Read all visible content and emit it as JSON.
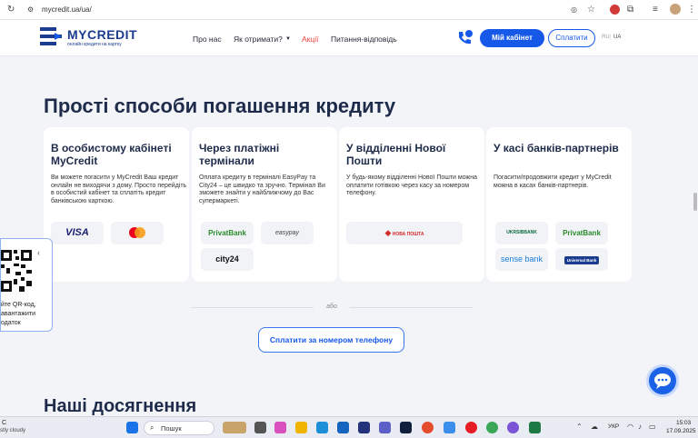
{
  "browser": {
    "url": "mycredit.ua/ua/"
  },
  "header": {
    "logo_name": "MYCREDIT",
    "logo_tagline": "онлайн кредити на картку",
    "menu": [
      "Про нас",
      "Як отримати?",
      "Акції",
      "Питання-відповідь"
    ],
    "cabinet_button": "Мій кабінет",
    "pay_button": "Сплатити",
    "lang": [
      "RU",
      "UA"
    ]
  },
  "section_title": "Прості способи погашення кредиту",
  "cards": [
    {
      "title": "В особистому кабінеті MyCredit",
      "text": "Ви можете погасити у MyCredit Ваш кредит онлайн не виходячи з дому. Просто перейдіть в особистий кабінет та сплатіть кредит банківською карткою.",
      "logos": [
        "VISA",
        "Mastercard"
      ]
    },
    {
      "title": "Через платіжні термінали",
      "text": "Оплата кредиту в терміналі EasyPay та City24 – це швидко та зручно. Термінал Ви зможете знайти у найближчому до Вас супермаркеті.",
      "logos": [
        "PrivatBank",
        "easypay",
        "city24"
      ]
    },
    {
      "title": "У відділенні Нової Пошти",
      "text": "У будь-якому відділенні Нової Пошти можна оплатити готівкою через касу за номером телефону.",
      "logos": [
        "НОВА ПОШТА"
      ]
    },
    {
      "title": "У касі банків-партнерів",
      "text": "Погасити/продовжити кредит у MyCredit можна в касах банків-партнерів.",
      "logos": [
        "UKRSIBBANK",
        "PrivatBank",
        "sense bank",
        "Universal Bank"
      ]
    }
  ],
  "or_label": "або",
  "pay_by_phone_button": "Сплатити за номером телефону",
  "qr_text": "йте QR-код, авантажити одаток",
  "next_section_title": "Наші досягнення",
  "taskbar": {
    "weather": "C",
    "weather_desc": "stly cloudy",
    "search": "Пошук",
    "lang": "УКР",
    "time": "15:03",
    "date": "17.09.2025"
  },
  "colors": {
    "brand": "#1c3d8f",
    "accent": "#1658e8",
    "promo": "#e8413c"
  }
}
